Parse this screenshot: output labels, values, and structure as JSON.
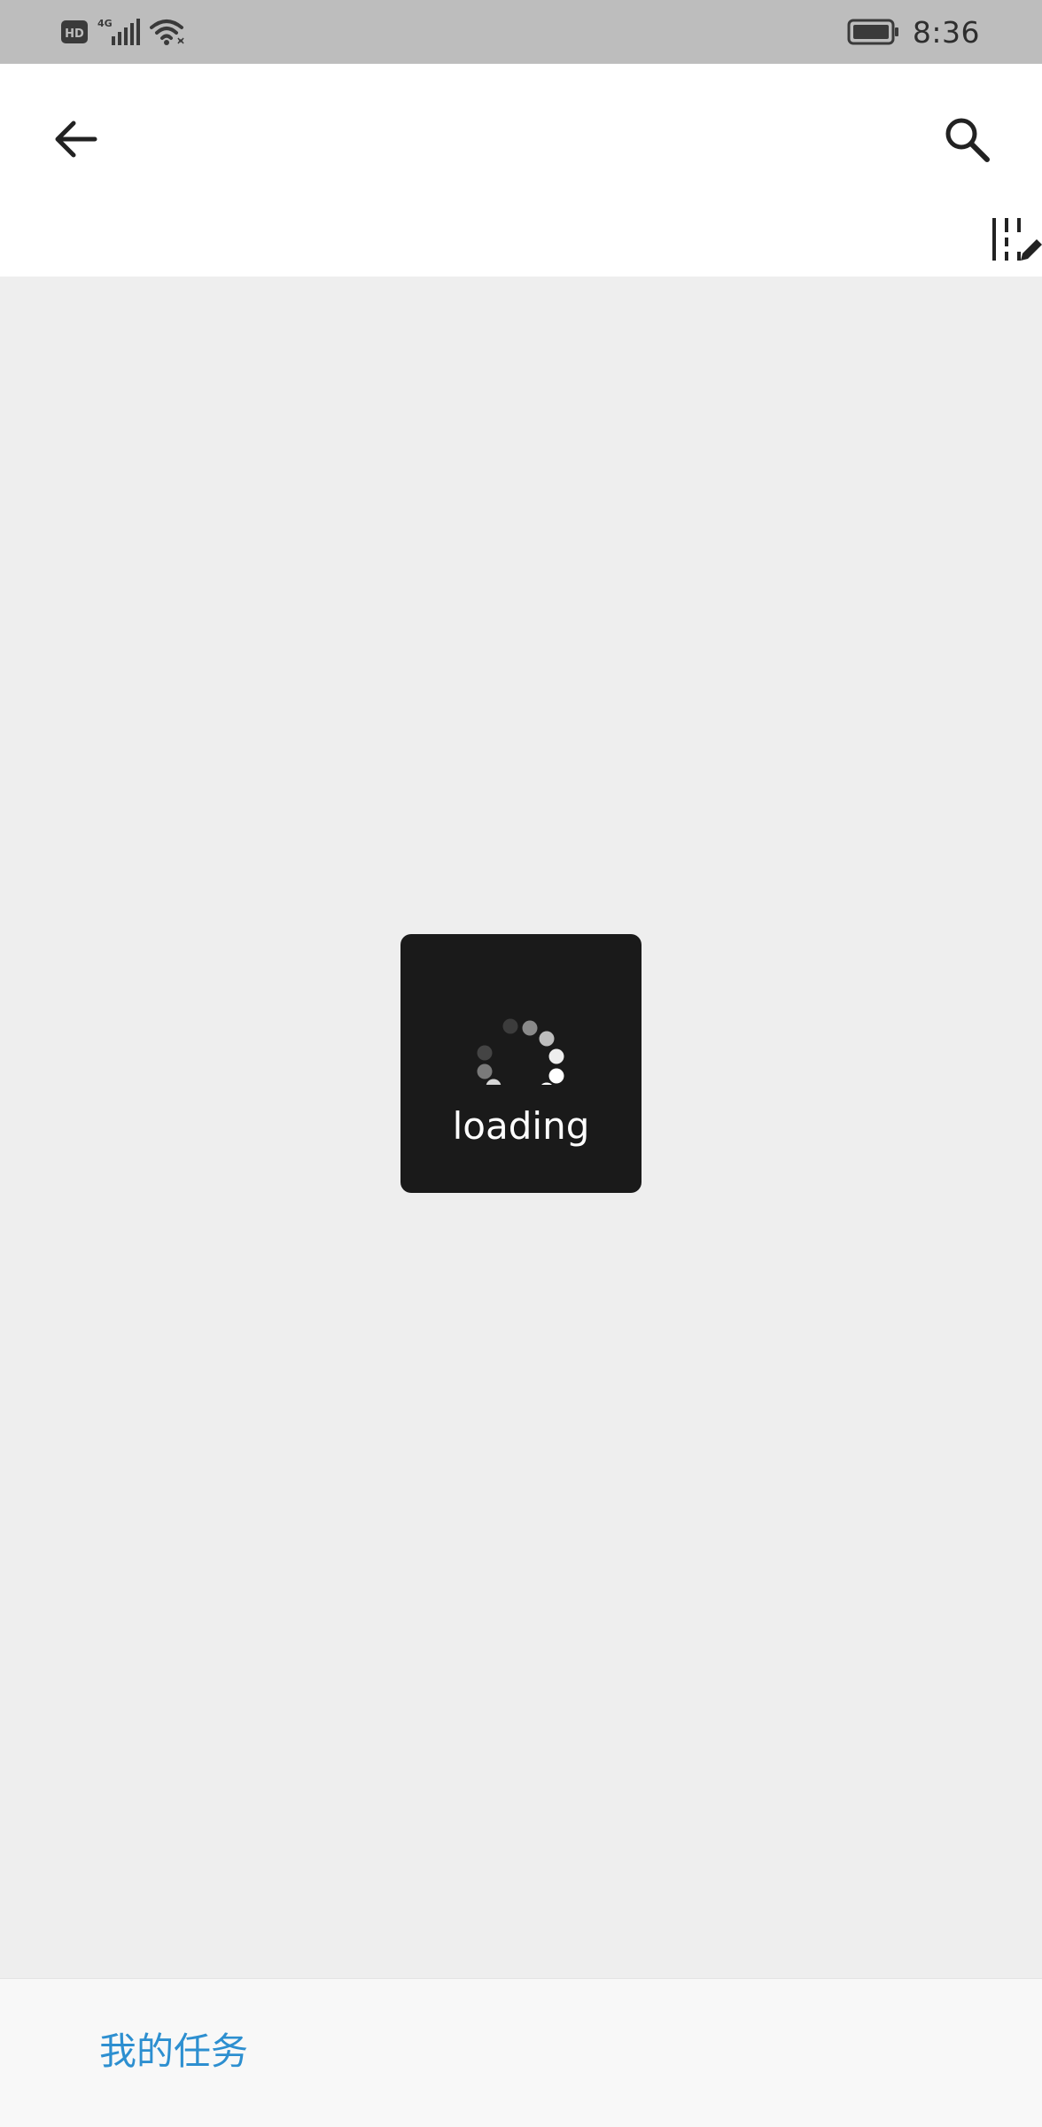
{
  "status_bar": {
    "network_badge": "HD",
    "network_type": "4G",
    "time": "8:36",
    "icons": [
      "hd-icon",
      "signal-icon",
      "wifi-icon",
      "battery-icon"
    ]
  },
  "app_bar": {
    "back_icon": "arrow-back-icon",
    "search_icon": "search-icon",
    "edit_columns_icon": "edit-columns-icon"
  },
  "loading": {
    "label": "loading"
  },
  "bottom_bar": {
    "my_tasks_label": "我的任务"
  },
  "colors": {
    "status_bar_bg": "#bdbdbd",
    "content_bg": "#eeeeee",
    "loading_bg": "#1a1a1a",
    "link_blue": "#2d8fd0"
  }
}
